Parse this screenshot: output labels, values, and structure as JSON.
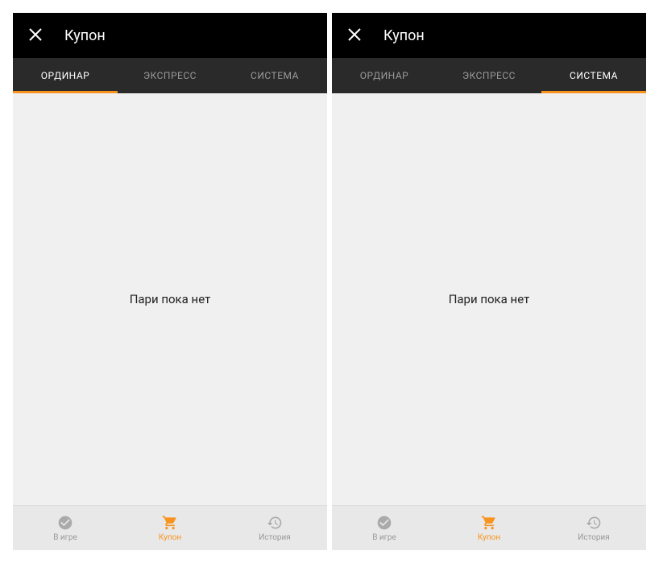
{
  "screen1": {
    "header": {
      "title": "Купон"
    },
    "tabs": [
      {
        "label": "ОРДИНАР",
        "active": true
      },
      {
        "label": "ЭКСПРЕСС",
        "active": false
      },
      {
        "label": "СИСТЕМА",
        "active": false
      }
    ],
    "content": {
      "empty_message": "Пари пока нет"
    },
    "bottom_nav": [
      {
        "label": "В игре",
        "icon": "check-circle",
        "active": false
      },
      {
        "label": "Купон",
        "icon": "cart",
        "active": true
      },
      {
        "label": "История",
        "icon": "history",
        "active": false
      }
    ]
  },
  "screen2": {
    "header": {
      "title": "Купон"
    },
    "tabs": [
      {
        "label": "ОРДИНАР",
        "active": false
      },
      {
        "label": "ЭКСПРЕСС",
        "active": false
      },
      {
        "label": "СИСТЕМА",
        "active": true
      }
    ],
    "content": {
      "empty_message": "Пари пока нет"
    },
    "bottom_nav": [
      {
        "label": "В игре",
        "icon": "check-circle",
        "active": false
      },
      {
        "label": "Купон",
        "icon": "cart",
        "active": true
      },
      {
        "label": "История",
        "icon": "history",
        "active": false
      }
    ]
  }
}
